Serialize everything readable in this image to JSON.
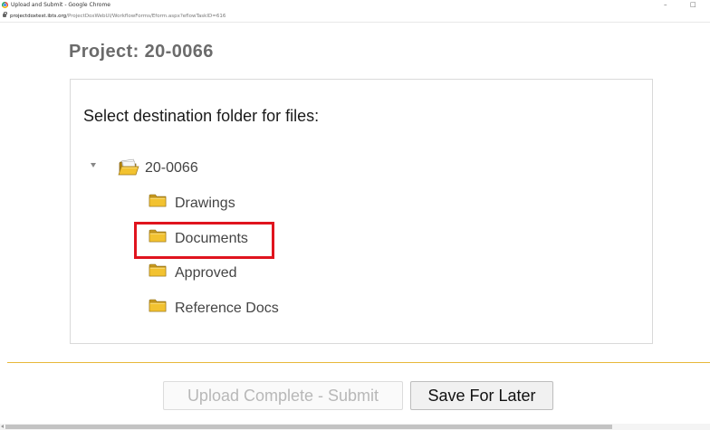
{
  "window": {
    "title": "Upload and Submit - Google Chrome",
    "url_host": "projectdoxtest.ibts.org",
    "url_path": "/ProjectDoxWebUI/WorkflowForms/Eform.aspx?eflowTaskID=616",
    "minimize_glyph": "–",
    "maximize_glyph": "□"
  },
  "page": {
    "project_title": "Project: 20-0066",
    "heading": "Select destination folder for files:"
  },
  "tree": {
    "root": {
      "label": "20-0066",
      "icon": "open-folder-icon",
      "expanded": true
    },
    "folders": [
      {
        "label": "Drawings",
        "icon": "folder-icon"
      },
      {
        "label": "Documents",
        "icon": "folder-icon",
        "highlighted": true
      },
      {
        "label": "Approved",
        "icon": "folder-icon"
      },
      {
        "label": "Reference Docs",
        "icon": "folder-icon"
      }
    ]
  },
  "buttons": {
    "submit_label": "Upload Complete - Submit",
    "submit_disabled": true,
    "save_label": "Save For Later"
  },
  "colors": {
    "highlight": "#e0141e",
    "divider": "#e8b83a",
    "folder_yellow": "#f2c230"
  }
}
